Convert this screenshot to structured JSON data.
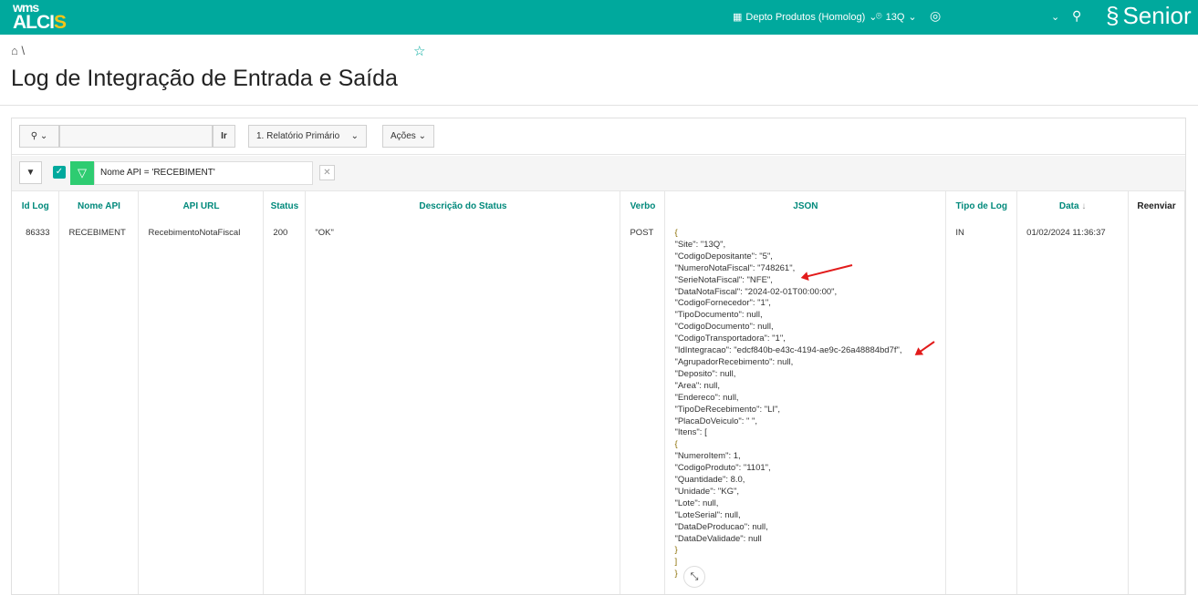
{
  "header": {
    "logo_top": "wms",
    "logo_main": "ALCI",
    "logo_accent": "S",
    "department": "Depto Produtos (Homolog)",
    "site": "13Q",
    "brand": "Senior"
  },
  "page": {
    "breadcrumb_sep": "\\",
    "title": "Log de Integração de Entrada e Saída"
  },
  "toolbar": {
    "search_value": "",
    "go_label": "Ir",
    "report_select": "1. Relatório Primário",
    "actions_label": "Ações"
  },
  "filter": {
    "text": "Nome API = 'RECEBIMENT'",
    "checked": true
  },
  "table": {
    "columns": [
      "Id Log",
      "Nome API",
      "API URL",
      "Status",
      "Descrição do Status",
      "Verbo",
      "JSON",
      "Tipo de Log",
      "Data",
      "Reenviar"
    ],
    "rows": [
      {
        "id_log": "86333",
        "nome_api": "RECEBIMENT",
        "api_url": "RecebimentoNotaFiscal",
        "status": "200",
        "descricao": "\"OK\"",
        "verbo": "POST",
        "tipo": "IN",
        "data": "01/02/2024 11:36:37",
        "json_lines": [
          "{",
          "\"Site\": \"13Q\",",
          "\"CodigoDepositante\": \"5\",",
          "\"NumeroNotaFiscal\": \"748261\",",
          "\"SerieNotaFiscal\": \"NFE\",",
          "\"DataNotaFiscal\": \"2024-02-01T00:00:00\",",
          "\"CodigoFornecedor\": \"1\",",
          "\"TipoDocumento\": null,",
          "\"CodigoDocumento\": null,",
          "\"CodigoTransportadora\": \"1\",",
          "\"IdIntegracao\": \"edcf840b-e43c-4194-ae9c-26a48884bd7f\",",
          "\"AgrupadorRecebimento\": null,",
          "\"Deposito\": null,",
          "\"Area\": null,",
          "\"Endereco\": null,",
          "\"TipoDeRecebimento\": \"LI\",",
          "\"PlacaDoVeiculo\": \" \",",
          "\"Itens\": [",
          "{",
          "\"NumeroItem\": 1,",
          "\"CodigoProduto\": \"1101\",",
          "\"Quantidade\": 8.0,",
          "\"Unidade\": \"KG\",",
          "\"Lote\": null,",
          "\"LoteSerial\": null,",
          "\"DataDeProducao\": null,",
          "\"DataDeValidade\": null",
          "}",
          "]",
          "}"
        ]
      }
    ]
  }
}
